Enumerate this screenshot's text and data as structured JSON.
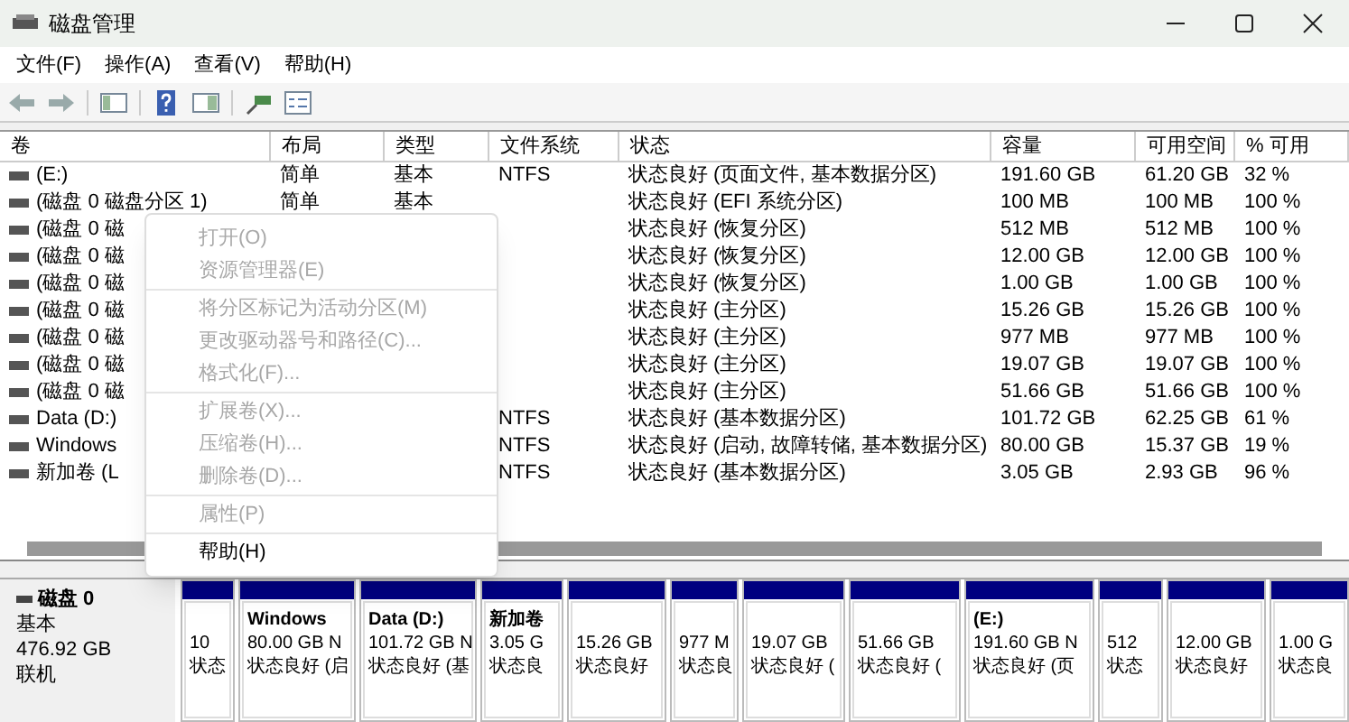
{
  "window": {
    "title": "磁盘管理"
  },
  "menu": [
    "文件(F)",
    "操作(A)",
    "查看(V)",
    "帮助(H)"
  ],
  "table": {
    "columns": [
      "卷",
      "布局",
      "类型",
      "文件系统",
      "状态",
      "容量",
      "可用空间",
      "% 可用"
    ],
    "rows": [
      {
        "volume": "(E:)",
        "layout": "简单",
        "type": "基本",
        "fs": "NTFS",
        "status": "状态良好 (页面文件, 基本数据分区)",
        "capacity": "191.60 GB",
        "free": "61.20 GB",
        "pct": "32 %"
      },
      {
        "volume": "(磁盘 0 磁盘分区 1)",
        "layout": "简单",
        "type": "基本",
        "status": "状态良好 (EFI 系统分区)",
        "capacity": "100 MB",
        "free": "100 MB",
        "pct": "100 %"
      },
      {
        "volume": "(磁盘 0 磁",
        "status": "状态良好 (恢复分区)",
        "capacity": "512 MB",
        "free": "512 MB",
        "pct": "100 %"
      },
      {
        "volume": "(磁盘 0 磁",
        "status": "状态良好 (恢复分区)",
        "capacity": "12.00 GB",
        "free": "12.00 GB",
        "pct": "100 %"
      },
      {
        "volume": "(磁盘 0 磁",
        "status": "状态良好 (恢复分区)",
        "capacity": "1.00 GB",
        "free": "1.00 GB",
        "pct": "100 %"
      },
      {
        "volume": "(磁盘 0 磁",
        "status": "状态良好 (主分区)",
        "capacity": "15.26 GB",
        "free": "15.26 GB",
        "pct": "100 %"
      },
      {
        "volume": "(磁盘 0 磁",
        "status": "状态良好 (主分区)",
        "capacity": "977 MB",
        "free": "977 MB",
        "pct": "100 %"
      },
      {
        "volume": "(磁盘 0 磁",
        "status": "状态良好 (主分区)",
        "capacity": "19.07 GB",
        "free": "19.07 GB",
        "pct": "100 %"
      },
      {
        "volume": "(磁盘 0 磁",
        "status": "状态良好 (主分区)",
        "capacity": "51.66 GB",
        "free": "51.66 GB",
        "pct": "100 %"
      },
      {
        "volume": "Data (D:)",
        "fs": "NTFS",
        "status": "状态良好 (基本数据分区)",
        "capacity": "101.72 GB",
        "free": "62.25 GB",
        "pct": "61 %"
      },
      {
        "volume": "Windows",
        "fs": "NTFS",
        "status": "状态良好 (启动, 故障转储, 基本数据分区)",
        "capacity": "80.00 GB",
        "free": "15.37 GB",
        "pct": "19 %"
      },
      {
        "volume": "新加卷 (L",
        "fs": "NTFS",
        "status": "状态良好 (基本数据分区)",
        "capacity": "3.05 GB",
        "free": "2.93 GB",
        "pct": "96 %"
      }
    ]
  },
  "context_menu": {
    "groups": [
      [
        {
          "label": "打开(O)",
          "disabled": true
        },
        {
          "label": "资源管理器(E)",
          "disabled": true
        }
      ],
      [
        {
          "label": "将分区标记为活动分区(M)",
          "disabled": true
        },
        {
          "label": "更改驱动器号和路径(C)...",
          "disabled": true
        },
        {
          "label": "格式化(F)...",
          "disabled": true
        }
      ],
      [
        {
          "label": "扩展卷(X)...",
          "disabled": true
        },
        {
          "label": "压缩卷(H)...",
          "disabled": true
        },
        {
          "label": "删除卷(D)...",
          "disabled": true
        }
      ],
      [
        {
          "label": "属性(P)",
          "disabled": true
        }
      ],
      [
        {
          "label": "帮助(H)",
          "disabled": false
        }
      ]
    ]
  },
  "disk": {
    "name": "磁盘 0",
    "type": "基本",
    "size": "476.92 GB",
    "status": "联机",
    "partitions": [
      {
        "lines": [
          "10",
          "状态"
        ]
      },
      {
        "title": "Windows",
        "lines": [
          "80.00 GB N",
          "状态良好 (启"
        ]
      },
      {
        "title": "Data  (D:)",
        "lines": [
          "101.72 GB N",
          "状态良好 (基"
        ]
      },
      {
        "title": "新加卷",
        "lines": [
          "3.05 G",
          "状态良"
        ]
      },
      {
        "lines": [
          "15.26 GB",
          "状态良好"
        ]
      },
      {
        "lines": [
          "977 M",
          "状态良"
        ]
      },
      {
        "lines": [
          "19.07 GB",
          "状态良好 ("
        ]
      },
      {
        "lines": [
          "51.66 GB",
          "状态良好 ("
        ]
      },
      {
        "title": "(E:)",
        "lines": [
          "191.60 GB N",
          "状态良好 (页"
        ]
      },
      {
        "lines": [
          "512",
          "状态"
        ]
      },
      {
        "lines": [
          "12.00 GB",
          "状态良好"
        ]
      },
      {
        "lines": [
          "1.00 G",
          "状态良"
        ]
      }
    ]
  }
}
